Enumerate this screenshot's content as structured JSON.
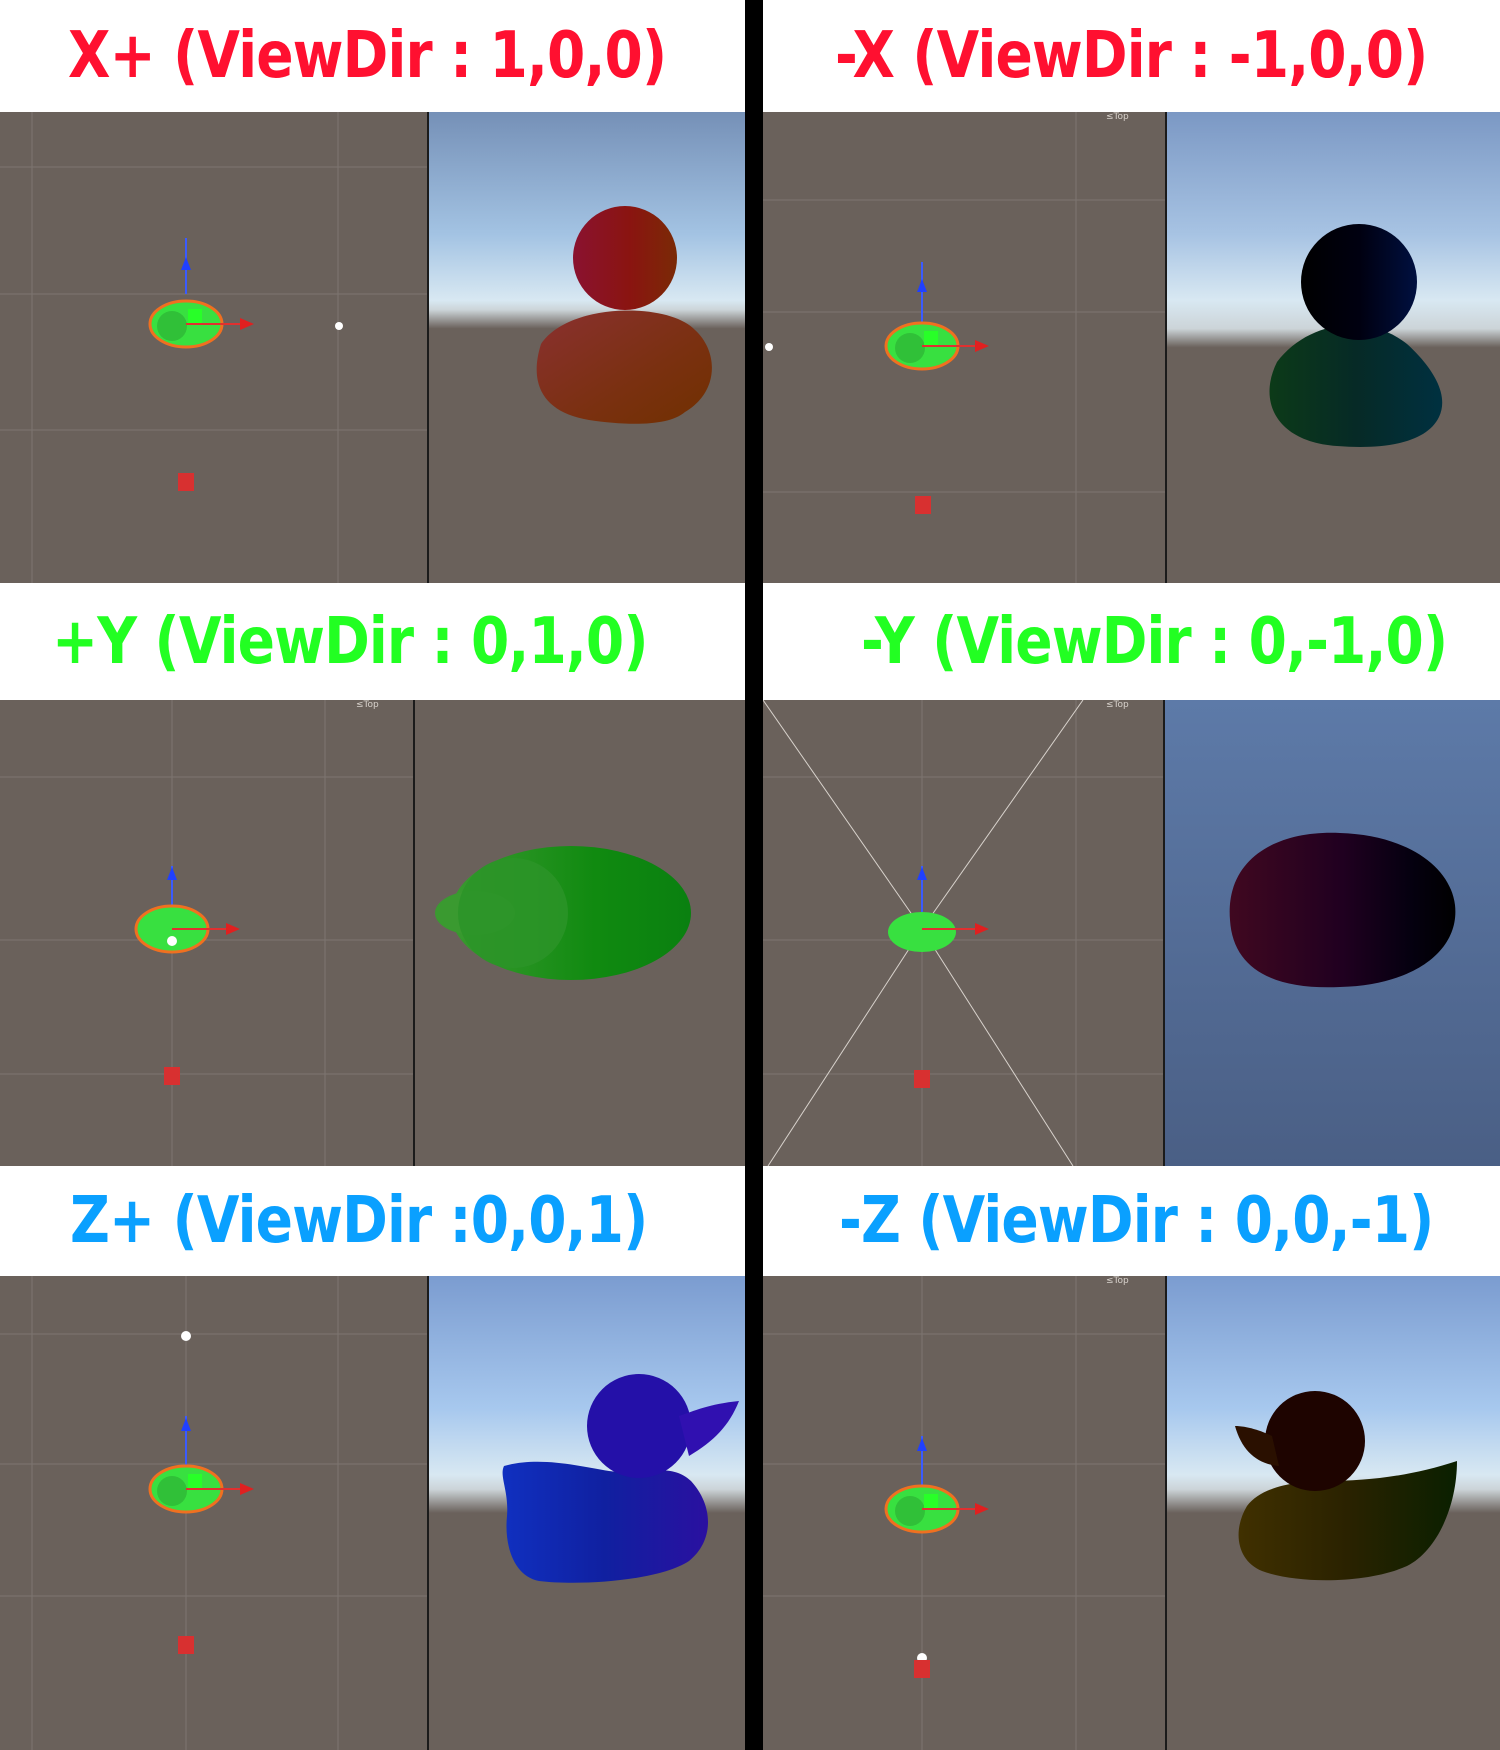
{
  "colors": {
    "red_title": "#ff1030",
    "green_title": "#22ff22",
    "blue_title": "#0aa0ff",
    "scene_bg": "#6a615b"
  },
  "panels": [
    {
      "id": "x-plus",
      "title": "X+ (ViewDir : 1,0,0)",
      "title_color": "#ff1030",
      "scene_label": "",
      "duck_view": "front",
      "duck_color": "red-orange"
    },
    {
      "id": "x-minus",
      "title": "-X (ViewDir : -1,0,0)",
      "title_color": "#ff1030",
      "scene_label": "Top",
      "duck_view": "front",
      "duck_color": "black-teal"
    },
    {
      "id": "y-plus",
      "title": "+Y (ViewDir : 0,1,0)",
      "title_color": "#22ff22",
      "scene_label": "Top",
      "duck_view": "top",
      "duck_color": "green"
    },
    {
      "id": "y-minus",
      "title": "-Y (ViewDir : 0,-1,0)",
      "title_color": "#22ff22",
      "scene_label": "Top",
      "duck_view": "bottom",
      "duck_color": "dark-purple"
    },
    {
      "id": "z-plus",
      "title": "Z+ (ViewDir :0,0,1)",
      "title_color": "#0aa0ff",
      "scene_label": "",
      "duck_view": "side-right",
      "duck_color": "blue"
    },
    {
      "id": "z-minus",
      "title": "-Z (ViewDir : 0,0,-1)",
      "title_color": "#0aa0ff",
      "scene_label": "Top",
      "duck_view": "side-left",
      "duck_color": "dark-olive"
    }
  ]
}
